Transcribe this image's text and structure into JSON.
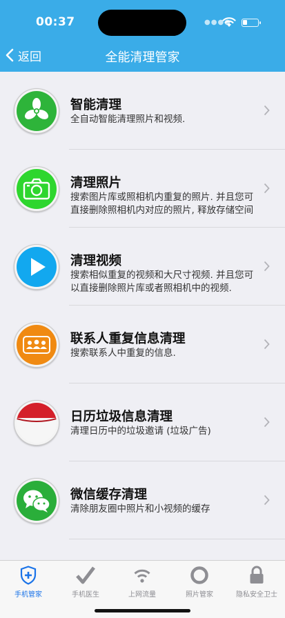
{
  "status": {
    "time": "00:37"
  },
  "nav": {
    "back_label": "返回",
    "title": "全能清理管家"
  },
  "items": [
    {
      "title": "智能清理",
      "desc": "全自动智能清理照片和视频.",
      "icon": "fan-icon",
      "color": "#2eb43a"
    },
    {
      "title": "清理照片",
      "desc": "搜索图片库或照相机内重复的照片. 并且您可直接删除照相机内对应的照片, 释放存储空间",
      "icon": "camera-icon",
      "color": "#2ed62e"
    },
    {
      "title": "清理视频",
      "desc": "搜索相似重复的视频和大尺寸视频. 并且您可以直接删除照片库或者照相机中的视频.",
      "icon": "play-icon",
      "color": "#12a8ef"
    },
    {
      "title": "联系人重复信息清理",
      "desc": "搜索联系人中重复的信息.",
      "icon": "contacts-icon",
      "color": "#f08a12"
    },
    {
      "title": "日历垃圾信息清理",
      "desc": "清理日历中的垃圾邀请 (垃圾广告)",
      "icon": "calendar-icon",
      "color": "#d4202a"
    },
    {
      "title": "微信缓存清理",
      "desc": "清除朋友圈中照片和小视频的缓存",
      "icon": "wechat-icon",
      "color": "#2aae3a"
    }
  ],
  "tabs": [
    {
      "label": "手机管家",
      "icon": "shield-plus-icon",
      "active": true
    },
    {
      "label": "手机医生",
      "icon": "checkmark-icon",
      "active": false
    },
    {
      "label": "上网流量",
      "icon": "wifi-icon",
      "active": false
    },
    {
      "label": "照片管家",
      "icon": "ring-icon",
      "active": false
    },
    {
      "label": "隐私安全卫士",
      "icon": "lock-icon",
      "active": false
    }
  ],
  "colors": {
    "accent": "#3aace8",
    "tab_active": "#1a73e8",
    "tab_inactive": "#8e8e93"
  }
}
